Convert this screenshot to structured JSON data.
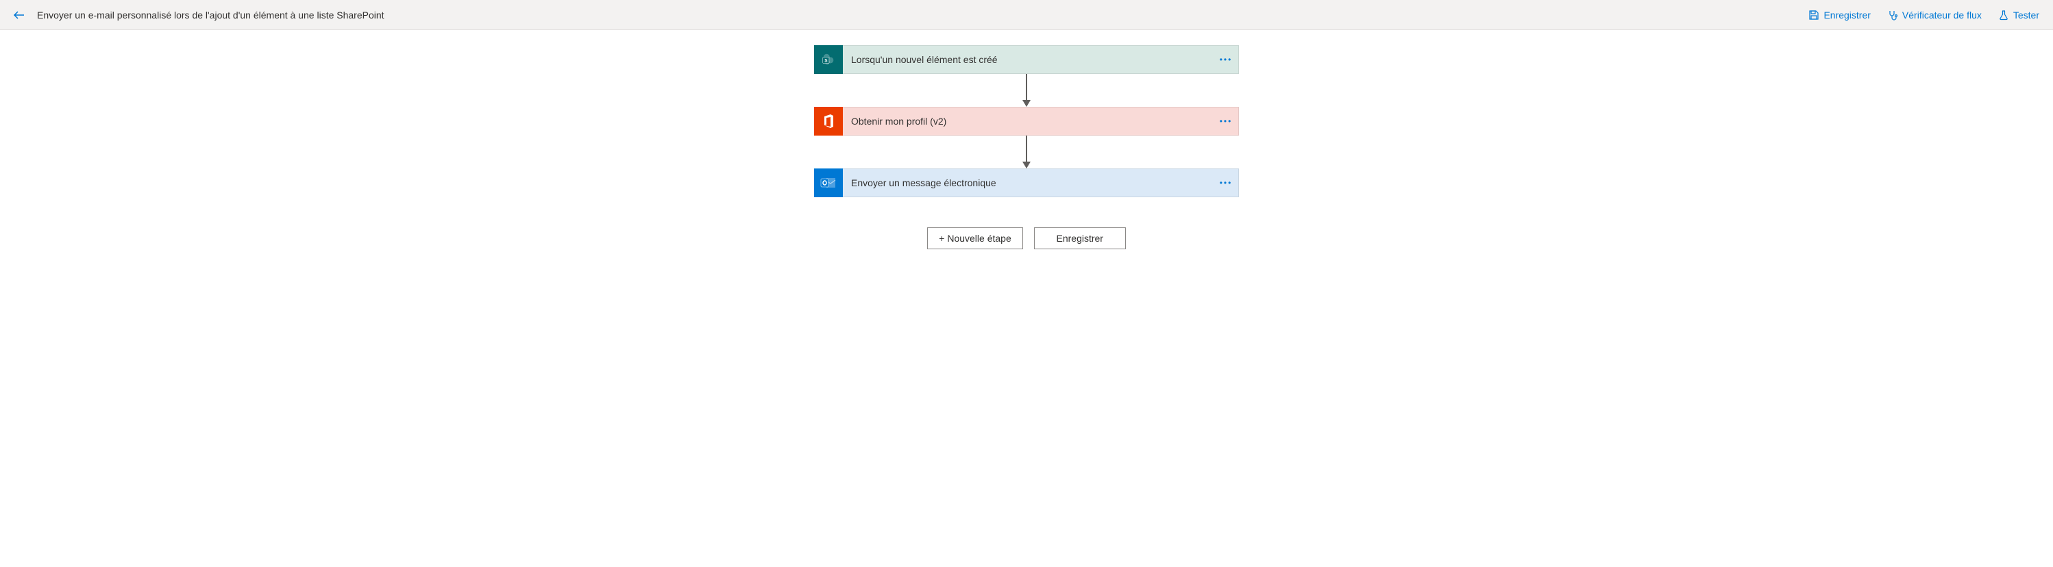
{
  "header": {
    "title": "Envoyer un e-mail personnalisé lors de l'ajout d'un élément à une liste SharePoint",
    "save_label": "Enregistrer",
    "checker_label": "Vérificateur de flux",
    "test_label": "Tester"
  },
  "steps": [
    {
      "label": "Lorsqu'un nouvel élément est créé",
      "connector": "sharepoint",
      "icon": "sharepoint"
    },
    {
      "label": "Obtenir mon profil (v2)",
      "connector": "office",
      "icon": "office"
    },
    {
      "label": "Envoyer un message électronique",
      "connector": "outlook",
      "icon": "outlook"
    }
  ],
  "actions": {
    "new_step": "+ Nouvelle étape",
    "save": "Enregistrer"
  }
}
